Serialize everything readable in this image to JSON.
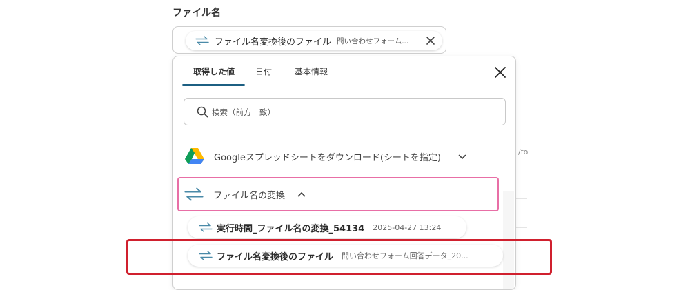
{
  "field": {
    "label": "ファイル名",
    "chip_label": "ファイル名変換後のファイル",
    "chip_value": "問い合わせフォーム..."
  },
  "background": {
    "fragment": "/fo"
  },
  "panel": {
    "tabs": [
      {
        "label": "取得した値",
        "active": true
      },
      {
        "label": "日付",
        "active": false
      },
      {
        "label": "基本情報",
        "active": false
      }
    ],
    "search": {
      "placeholder": "検索（前方一致）",
      "value": ""
    },
    "sections": [
      {
        "label": "Googleスプレッドシートをダウンロード(シートを指定)",
        "expanded": false,
        "icon": "google-drive-icon"
      },
      {
        "label": "ファイル名の変換",
        "expanded": true,
        "icon": "transform-arrows-icon"
      }
    ],
    "items": [
      {
        "label": "実行時間_ファイル名の変換_54134",
        "value": "2025-04-27 13:24"
      },
      {
        "label": "ファイル名変換後のファイル",
        "value": "問い合わせフォーム回答データ_20..."
      }
    ]
  },
  "colors": {
    "tab_underline": "#1c5f82",
    "active_section_border": "#e86fa6",
    "highlight_box": "#d0202e",
    "transform_icon": "#4a8aa8"
  }
}
